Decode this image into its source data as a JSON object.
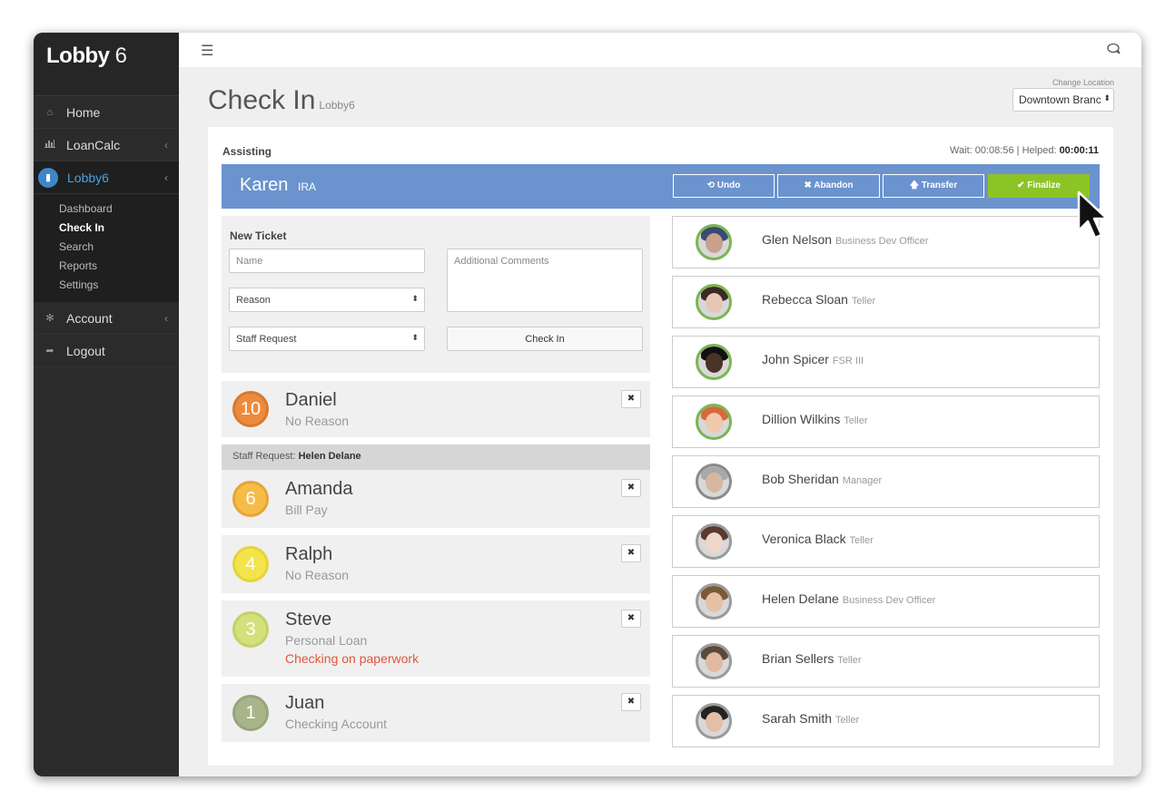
{
  "app": {
    "logo_bold": "Lobby",
    "logo_light": " 6"
  },
  "sidebar": {
    "items": [
      {
        "label": "Home",
        "icon": "home-icon"
      },
      {
        "label": "LoanCalc",
        "icon": "chart-icon"
      },
      {
        "label": "Lobby6",
        "icon": "tablet-icon"
      },
      {
        "label": "Account",
        "icon": "gear-icon"
      },
      {
        "label": "Logout",
        "icon": "signout-icon"
      }
    ],
    "subitems": [
      "Dashboard",
      "Check In",
      "Search",
      "Reports",
      "Settings"
    ]
  },
  "header": {
    "title": "Check In",
    "subtitle": "Lobby6",
    "location_label": "Change Location",
    "location_value": "Downtown Branch"
  },
  "assisting": {
    "label": "Assisting",
    "wait_label": "Wait: ",
    "wait_value": "00:08:56",
    "sep": " | ",
    "helped_label": "Helped: ",
    "helped_value": "00:00:11",
    "customer_name": "Karen",
    "customer_reason": "IRA",
    "buttons": {
      "undo": "⟲ Undo",
      "abandon": "✖ Abandon",
      "transfer": "🡅 Transfer",
      "finalize": "✔ Finalize"
    }
  },
  "new_ticket": {
    "title": "New Ticket",
    "name_placeholder": "Name",
    "comments_placeholder": "Additional Comments",
    "reason_value": "Reason",
    "staff_value": "Staff Request",
    "checkin_label": "Check In"
  },
  "queue": [
    {
      "number": "10",
      "name": "Daniel",
      "reason": "No Reason",
      "note": "",
      "color": "#ee8a3c"
    },
    {
      "number": "6",
      "name": "Amanda",
      "reason": "Bill Pay",
      "note": "",
      "color": "#f5bc48"
    },
    {
      "number": "4",
      "name": "Ralph",
      "reason": "No Reason",
      "note": "",
      "color": "#f2e44a"
    },
    {
      "number": "3",
      "name": "Steve",
      "reason": "Personal Loan",
      "note": "Checking on paperwork",
      "color": "#d4e07a"
    },
    {
      "number": "1",
      "name": "Juan",
      "reason": "Checking Account",
      "note": "",
      "color": "#a8b48a"
    }
  ],
  "staff_request": {
    "label": "Staff Request: ",
    "name": "Helen Delane"
  },
  "staff": [
    {
      "name": "Glen Nelson",
      "role": "Business Dev Officer",
      "ring": "#7bb551",
      "skin": "#c9a08c",
      "hair": "#3a4a72"
    },
    {
      "name": "Rebecca Sloan",
      "role": "Teller",
      "ring": "#7bb551",
      "skin": "#e4c7b7",
      "hair": "#3b2a22"
    },
    {
      "name": "John Spicer",
      "role": "FSR III",
      "ring": "#7bb551",
      "skin": "#4a3326",
      "hair": "#111111"
    },
    {
      "name": "Dillion Wilkins",
      "role": "Teller",
      "ring": "#7bb551",
      "skin": "#f1c8ad",
      "hair": "#d66a3c"
    },
    {
      "name": "Bob Sheridan",
      "role": "Manager",
      "ring": "#8a8a8a",
      "skin": "#d7b7a1",
      "hair": "#a9a9a9"
    },
    {
      "name": "Veronica Black",
      "role": "Teller",
      "ring": "#9a9a9a",
      "skin": "#f0d6c8",
      "hair": "#5a3a2c"
    },
    {
      "name": "Helen Delane",
      "role": "Business Dev Officer",
      "ring": "#9a9a9a",
      "skin": "#e4c1a5",
      "hair": "#7a5a38"
    },
    {
      "name": "Brian Sellers",
      "role": "Teller",
      "ring": "#9a9a9a",
      "skin": "#e0b9a0",
      "hair": "#5a4a38"
    },
    {
      "name": "Sarah Smith",
      "role": "Teller",
      "ring": "#9a9a9a",
      "skin": "#e3bfa5",
      "hair": "#222222"
    }
  ]
}
